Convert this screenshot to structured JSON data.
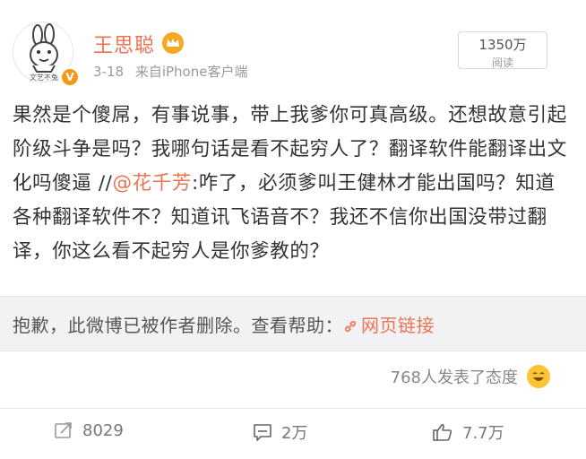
{
  "user": {
    "name": "王思聪",
    "avatar_caption": "文艺不兔",
    "verified_badge": "V"
  },
  "meta": {
    "date": "3-18",
    "source": "来自iPhone客户端"
  },
  "reads": {
    "count": "1350万",
    "label": "阅读"
  },
  "content": {
    "part1": "果然是个傻屌，有事说事，带上我爹你可真高级。还想故意引起阶级斗争是吗？我哪句话是看不起穷人了？翻译软件能翻译出文化吗傻逼 //",
    "mention": "@花千芳",
    "part2": ":咋了，必须爹叫王健林才能出国吗？知道各种翻译软件不？知道讯飞语音不？我还不信你出国没带过翻译，你这么看不起穷人是你爹教的？"
  },
  "deleted": {
    "text": "抱歉，此微博已被作者删除。查看帮助：",
    "link": "网页链接"
  },
  "attitudes": {
    "text": "768人发表了态度"
  },
  "actions": {
    "repost": "8029",
    "comment": "2万",
    "like": "7.7万"
  },
  "colors": {
    "accent": "#eb7350",
    "muted": "#999999",
    "notice_bg": "#f2f2f5"
  }
}
